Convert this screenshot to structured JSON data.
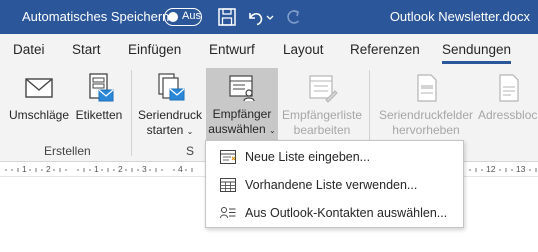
{
  "titlebar": {
    "autosave_label": "Automatisches Speichern",
    "autosave_state": "Aus",
    "document_title": "Outlook Newsletter.docx",
    "qat": [
      {
        "name": "save-icon"
      },
      {
        "name": "undo-icon"
      },
      {
        "name": "undo-dropdown-icon"
      },
      {
        "name": "redo-icon"
      }
    ]
  },
  "tabs": [
    "Datei",
    "Start",
    "Einfügen",
    "Entwurf",
    "Layout",
    "Referenzen",
    "Sendungen"
  ],
  "active_tab": "Sendungen",
  "ribbon": {
    "groups": [
      {
        "label": "Erstellen"
      },
      {
        "label": "S"
      }
    ],
    "buttons": {
      "umschlaege": "Umschläge",
      "etiketten": "Etiketten",
      "seriendruck_l1": "Seriendruck",
      "seriendruck_l2": "starten",
      "empfaenger_l1": "Empfänger",
      "empfaenger_l2": "auswählen",
      "liste_l1": "Empfängerliste",
      "liste_l2": "bearbeiten",
      "felder_l1": "Seriendruckfelder",
      "felder_l2": "hervorheben",
      "adressblock": "Adressblock"
    }
  },
  "ruler": {
    "marks_left": [
      "1",
      "2",
      "1",
      "2",
      "3",
      "4"
    ],
    "marks_right": [
      "12",
      "13"
    ]
  },
  "dropdown": {
    "items": [
      {
        "label": "Neue Liste eingeben...",
        "icon": "new-list-icon"
      },
      {
        "label": "Vorhandene Liste verwenden...",
        "icon": "existing-list-icon"
      },
      {
        "label": "Aus Outlook-Kontakten auswählen...",
        "icon": "outlook-contacts-icon"
      }
    ]
  },
  "colors": {
    "accent": "#2b579a",
    "ribbon_bg": "#f3f3f3",
    "pressed_bg": "#c8c8c8"
  }
}
